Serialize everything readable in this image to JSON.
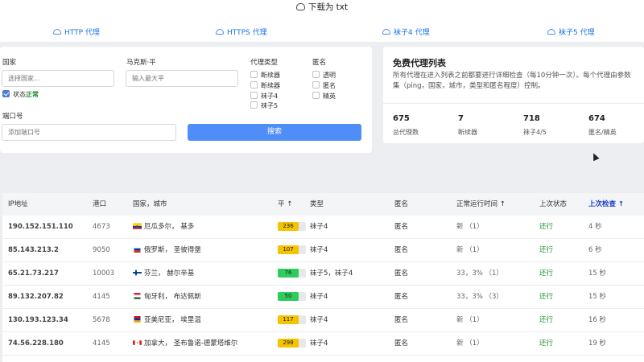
{
  "download": {
    "label": "下载为 txt",
    "icon": "cloud-download-icon"
  },
  "proxy_tabs": [
    {
      "label": "HTTP 代理",
      "icon": "cloud-download-icon"
    },
    {
      "label": "HTTPS 代理",
      "icon": "cloud-download-icon"
    },
    {
      "label": "袜子4 代理",
      "icon": "cloud-download-icon"
    },
    {
      "label": "袜子5 代理",
      "icon": "cloud-download-icon"
    }
  ],
  "filters": {
    "country_label": "国家",
    "country_placeholder": "选择国家...",
    "status_checked": true,
    "status_prefix": "状态",
    "status_value": "正常",
    "maxping_label": "马克斯·平",
    "maxping_placeholder": "输入最大平",
    "proxy_type_label": "代理类型",
    "proxy_types": [
      "断续器",
      "断续器",
      "袜子4",
      "袜子5"
    ],
    "anon_label": "匿名",
    "anon_types": [
      "透明",
      "匿名",
      "精英"
    ],
    "port_label": "端口号",
    "port_placeholder": "添加端口号",
    "search_button": "搜索"
  },
  "free_list": {
    "title": "免费代理列表",
    "description": "所有代理在进入列表之前都要进行详细检查（每10分钟一次）。每个代理由参数集（ping，国家，城市，类型和匿名程度）控制。",
    "stats": [
      {
        "value": "675",
        "label": "总代理数"
      },
      {
        "value": "7",
        "label": "断续器"
      },
      {
        "value": "718",
        "label": "袜子4/5"
      },
      {
        "value": "674",
        "label": "匿名/精英"
      }
    ]
  },
  "table": {
    "headers": [
      "IP地址",
      "港口",
      "国家，城市",
      "平 ↑",
      "类型",
      "匿名",
      "正常运行时间 ↑",
      "上次状态",
      "上次检查 ↑"
    ],
    "rows": [
      {
        "ip": "190.152.151.110",
        "port": "4673",
        "flag": "ecuador",
        "location": "厄瓜多尔， 基多",
        "ping": "236",
        "ping_color": "#f5c400",
        "ping_fill": 0.75,
        "type": "袜子4",
        "anon": "匿名",
        "uptime": "新 （1）",
        "state": "还行",
        "checked": "4 秒"
      },
      {
        "ip": "85.143.213.2",
        "port": "9050",
        "flag": "russia",
        "location": "俄罗斯， 圣彼得堡",
        "ping": "107",
        "ping_color": "#f5c400",
        "ping_fill": 0.75,
        "type": "袜子4",
        "anon": "匿名",
        "uptime": "新 （1）",
        "state": "还行",
        "checked": "6 秒"
      },
      {
        "ip": "65.21.73.217",
        "port": "10003",
        "flag": "finland",
        "location": "芬兰， 赫尔辛基",
        "ping": "76",
        "ping_color": "#2ecc5a",
        "ping_fill": 0.75,
        "type": "袜子5，袜子4",
        "anon": "匿名",
        "uptime": "33，3% （1）",
        "state": "还行",
        "checked": "15 秒"
      },
      {
        "ip": "89.132.207.82",
        "port": "4145",
        "flag": "hungary",
        "location": "匈牙利， 布达佩斯",
        "ping": "50",
        "ping_color": "#2ecc5a",
        "ping_fill": 0.75,
        "type": "袜子4",
        "anon": "匿名",
        "uptime": "33，3% （3）",
        "state": "还行",
        "checked": "15 秒"
      },
      {
        "ip": "130.193.123.34",
        "port": "5678",
        "flag": "armenia",
        "location": "亚美尼亚， 埃里温",
        "ping": "117",
        "ping_color": "#f5c400",
        "ping_fill": 0.75,
        "type": "袜子4",
        "anon": "匿名",
        "uptime": "新 （1）",
        "state": "还行",
        "checked": "16 秒"
      },
      {
        "ip": "74.56.228.180",
        "port": "4145",
        "flag": "canada",
        "location": "加拿大， 圣布鲁诺-德蒙塔维尔",
        "ping": "298",
        "ping_color": "#f5c400",
        "ping_fill": 0.75,
        "type": "袜子4",
        "anon": "匿名",
        "uptime": "新 （1）",
        "state": "还行",
        "checked": "19 秒"
      }
    ]
  }
}
